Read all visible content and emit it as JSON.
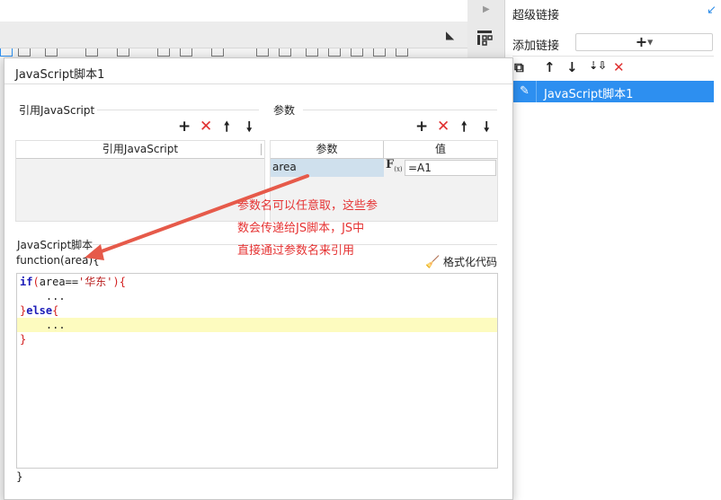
{
  "right_panel": {
    "title": "超级链接",
    "collapse_icon": "collapse-arrow-icon",
    "add_link_label": "添加链接",
    "add_link_button": "+",
    "list": [
      {
        "label": "JavaScript脚本1",
        "icon": "pencil-icon"
      }
    ]
  },
  "dialog": {
    "title": "JavaScript脚本1",
    "ref_section": {
      "label": "引用JavaScript",
      "column_header": "引用JavaScript"
    },
    "param_section": {
      "label": "参数",
      "columns": [
        "参数",
        "值"
      ],
      "rows": [
        {
          "name": "area",
          "fx": "F",
          "fx_sub": "(x)",
          "value": "=A1"
        }
      ]
    },
    "script_section": {
      "label": "JavaScript脚本",
      "signature": "function(area){",
      "format_button": "格式化代码",
      "closing": "}"
    },
    "code_lines": {
      "l1_kw": "if",
      "l1_open": "(",
      "l1_var": "area",
      "l1_op": "==",
      "l1_str": "'华东'",
      "l1_close": ")",
      "l1_brace": "{",
      "l2": "    ...",
      "l3_brace1": "}",
      "l3_kw": "else",
      "l3_brace2": "{",
      "l4": "    ...",
      "l5_brace": "}"
    }
  },
  "annotation": {
    "line1": "参数名可以任意取，这些参",
    "line2": "数会传递给JS脚本，JS中",
    "line3": "直接通过参数名来引用"
  },
  "colors": {
    "accent": "#2d8ff0",
    "delete": "#e03030",
    "annotation": "#e53333",
    "selected_param": "#cfe0ed",
    "code_highlight": "#fdfbbf"
  }
}
